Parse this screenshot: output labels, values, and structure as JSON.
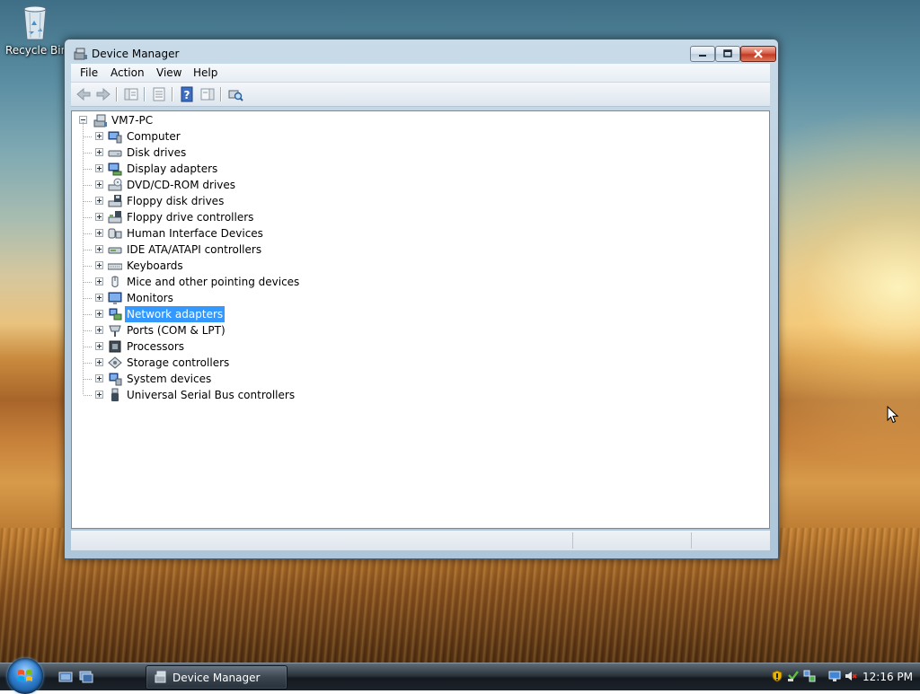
{
  "desktop": {
    "recycle_bin_label": "Recycle Bin"
  },
  "window": {
    "title": "Device Manager",
    "menu": [
      "File",
      "Action",
      "View",
      "Help"
    ],
    "toolbar_icons": [
      "back-icon",
      "forward-icon",
      "console-tree-icon",
      "properties-icon",
      "help-icon",
      "action-pane-icon",
      "scan-hardware-icon"
    ],
    "tree": {
      "root_label": "VM7-PC",
      "selected": "Network adapters",
      "categories": [
        {
          "label": "Computer",
          "icon": "computer-icon"
        },
        {
          "label": "Disk drives",
          "icon": "disk-drive-icon"
        },
        {
          "label": "Display adapters",
          "icon": "display-adapter-icon"
        },
        {
          "label": "DVD/CD-ROM drives",
          "icon": "dvd-drive-icon"
        },
        {
          "label": "Floppy disk drives",
          "icon": "floppy-drive-icon"
        },
        {
          "label": "Floppy drive controllers",
          "icon": "floppy-controller-icon"
        },
        {
          "label": "Human Interface Devices",
          "icon": "hid-icon"
        },
        {
          "label": "IDE ATA/ATAPI controllers",
          "icon": "ide-controller-icon"
        },
        {
          "label": "Keyboards",
          "icon": "keyboard-icon"
        },
        {
          "label": "Mice and other pointing devices",
          "icon": "mouse-icon"
        },
        {
          "label": "Monitors",
          "icon": "monitor-icon"
        },
        {
          "label": "Network adapters",
          "icon": "network-adapter-icon"
        },
        {
          "label": "Ports (COM & LPT)",
          "icon": "port-icon"
        },
        {
          "label": "Processors",
          "icon": "processor-icon"
        },
        {
          "label": "Storage controllers",
          "icon": "storage-controller-icon"
        },
        {
          "label": "System devices",
          "icon": "system-devices-icon"
        },
        {
          "label": "Universal Serial Bus controllers",
          "icon": "usb-icon"
        }
      ]
    }
  },
  "taskbar": {
    "task_label": "Device Manager",
    "clock": "12:16 PM",
    "tray_icons": [
      "security-shield-icon",
      "windows-update-icon",
      "network-icon",
      "display-icon",
      "volume-muted-icon"
    ]
  },
  "colors": {
    "selection": "#3399ff",
    "title_bar": "#b7cee0"
  }
}
